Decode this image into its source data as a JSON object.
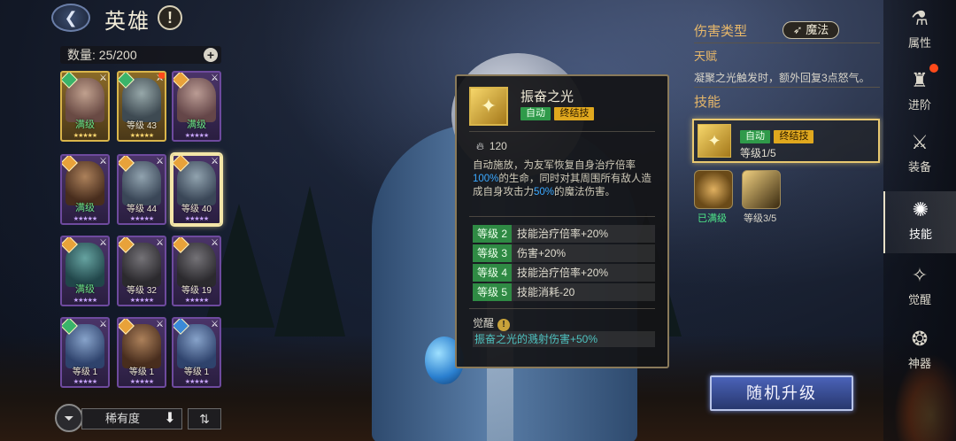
{
  "header": {
    "title": "英雄",
    "info_icon": "info-icon"
  },
  "roster": {
    "count_label": "数量: 25/200",
    "heroes": [
      {
        "level_text": "满级",
        "max": true,
        "frame": "gold",
        "elem": "green",
        "portrait": "p1",
        "dot": false
      },
      {
        "level_text": "等级 43",
        "max": false,
        "frame": "gold",
        "elem": "green",
        "portrait": "p2",
        "dot": true
      },
      {
        "level_text": "满级",
        "max": true,
        "frame": "purple",
        "elem": "gold",
        "portrait": "p1",
        "dot": false
      },
      {
        "level_text": "满级",
        "max": true,
        "frame": "purple",
        "elem": "gold",
        "portrait": "p6",
        "dot": false
      },
      {
        "level_text": "等级 44",
        "max": false,
        "frame": "purple",
        "elem": "gold",
        "portrait": "p2",
        "dot": false
      },
      {
        "level_text": "等级 40",
        "max": false,
        "frame": "purple",
        "elem": "gold",
        "portrait": "p2",
        "dot": false,
        "selected": true
      },
      {
        "level_text": "满级",
        "max": true,
        "frame": "purple",
        "elem": "gold",
        "portrait": "p5",
        "dot": false
      },
      {
        "level_text": "等级 32",
        "max": false,
        "frame": "purple",
        "elem": "gold",
        "portrait": "p4",
        "dot": false
      },
      {
        "level_text": "等级 19",
        "max": false,
        "frame": "purple",
        "elem": "gold",
        "portrait": "p4",
        "dot": false
      },
      {
        "level_text": "等级 1",
        "max": false,
        "frame": "purple",
        "elem": "green",
        "portrait": "p3",
        "dot": false
      },
      {
        "level_text": "等级 1",
        "max": false,
        "frame": "purple",
        "elem": "gold",
        "portrait": "p6",
        "dot": false
      },
      {
        "level_text": "等级 1",
        "max": false,
        "frame": "purple",
        "elem": "blue",
        "portrait": "p3",
        "dot": false
      }
    ],
    "sort_label": "稀有度"
  },
  "tooltip": {
    "skill_name": "振奋之光",
    "tag_auto": "自动",
    "tag_ult": "终结技",
    "cost": "120",
    "desc_a": "自动施放，为友军恢复自身治疗倍率",
    "desc_hl1": "100%",
    "desc_b": "的生命，同时对其周围所有敌人造成自身攻击力",
    "desc_hl2": "50%",
    "desc_c": "的魔法伤害。",
    "levels": [
      {
        "lv": "等级 2",
        "text": "技能治疗倍率+20%"
      },
      {
        "lv": "等级 3",
        "text": "伤害+20%"
      },
      {
        "lv": "等级 4",
        "text": "技能治疗倍率+20%"
      },
      {
        "lv": "等级 5",
        "text": "技能消耗-20"
      }
    ],
    "awaken_label": "觉醒",
    "awaken_text": "振奋之光的溅射伤害+50%"
  },
  "info_panel": {
    "damage_type_label": "伤害类型",
    "damage_type_value": "魔法",
    "talent_label": "天赋",
    "talent_text": "凝聚之光触发时，额外回复3点怒气。",
    "skill_label": "技能",
    "skill_tag_auto": "自动",
    "skill_tag_ult": "终结技",
    "skill_level": "等级1/5",
    "sub1_caption": "已满级",
    "sub2_caption": "等级3/5",
    "upgrade_button": "随机升级"
  },
  "nav": [
    {
      "label": "属性",
      "icon": "attributes-icon",
      "glyph": "⚗"
    },
    {
      "label": "进阶",
      "icon": "advance-icon",
      "glyph": "♜",
      "dot": true
    },
    {
      "label": "装备",
      "icon": "equipment-icon",
      "glyph": "⚔"
    },
    {
      "label": "技能",
      "icon": "skill-icon",
      "glyph": "✺",
      "active": true
    },
    {
      "label": "觉醒",
      "icon": "awaken-icon",
      "glyph": "✧"
    },
    {
      "label": "神器",
      "icon": "artifact-icon",
      "glyph": "❂"
    }
  ]
}
